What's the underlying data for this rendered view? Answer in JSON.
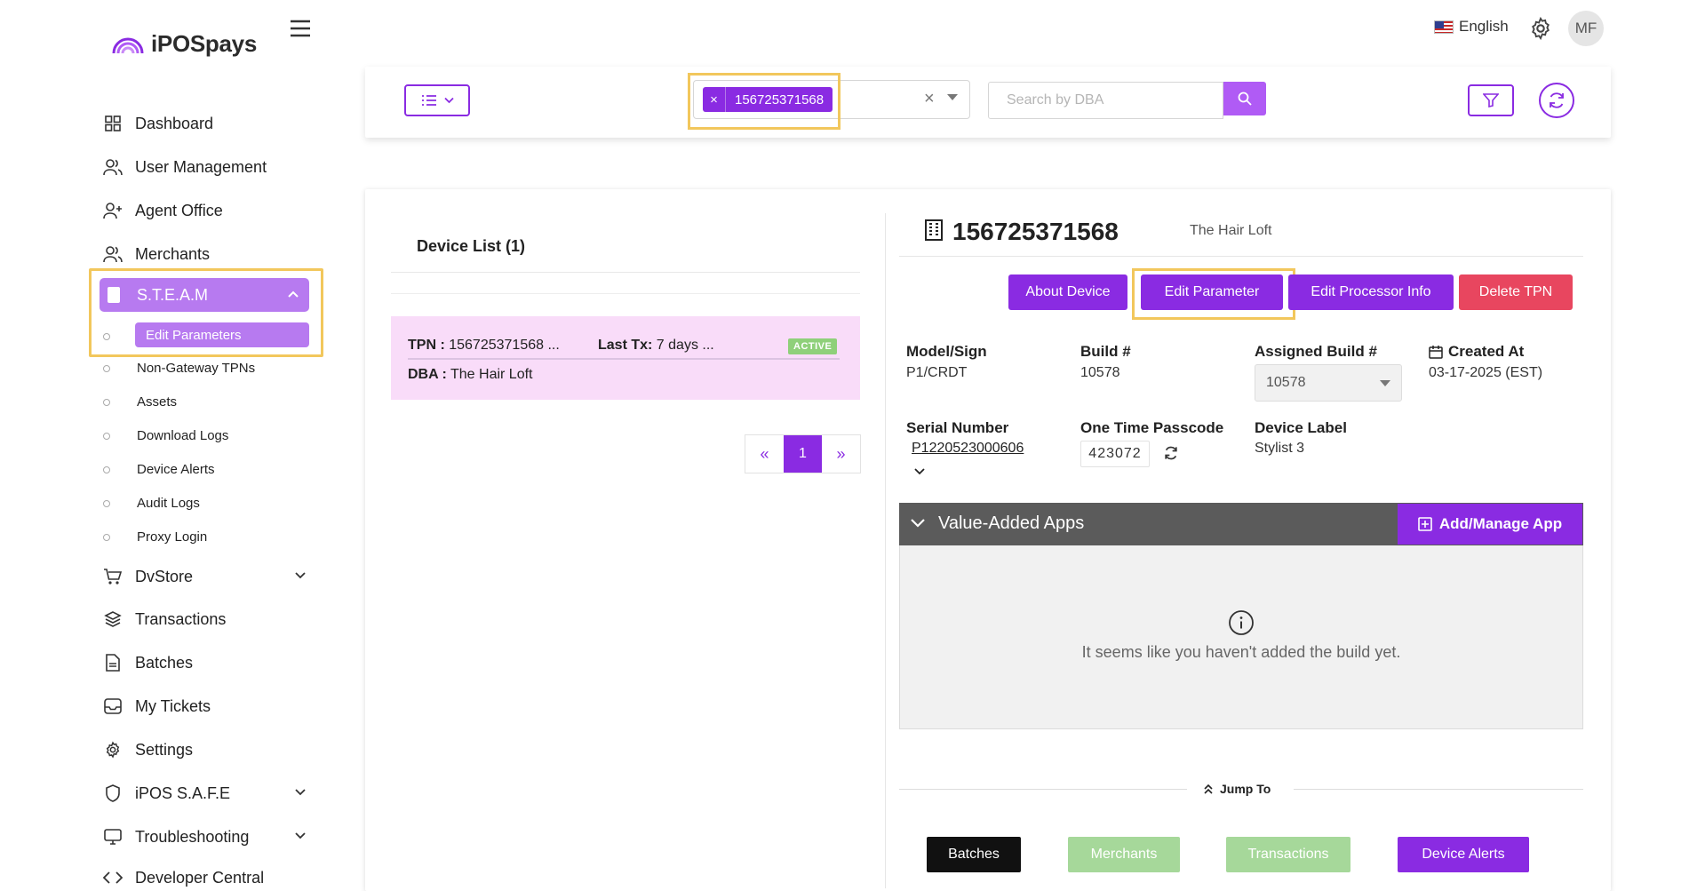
{
  "brand": {
    "name": "iPOSpays"
  },
  "header": {
    "language": "English",
    "avatar_initials": "MF"
  },
  "sidebar": {
    "items": [
      {
        "label": "Dashboard",
        "icon": "grid-icon"
      },
      {
        "label": "User Management",
        "icon": "users-icon"
      },
      {
        "label": "Agent Office",
        "icon": "user-plus-icon"
      },
      {
        "label": "Merchants",
        "icon": "users-icon"
      },
      {
        "label": "S.T.E.A.M",
        "icon": "document-icon",
        "expanded": true,
        "active": true
      }
    ],
    "steam_subitems": [
      {
        "label": "Edit Parameters",
        "active": true
      },
      {
        "label": "Non-Gateway TPNs"
      },
      {
        "label": "Assets"
      },
      {
        "label": "Download Logs"
      },
      {
        "label": "Device Alerts"
      },
      {
        "label": "Audit Logs"
      },
      {
        "label": "Proxy Login"
      }
    ],
    "lower_items": [
      {
        "label": "DvStore",
        "icon": "cart-icon",
        "has_children": true
      },
      {
        "label": "Transactions",
        "icon": "layers-icon"
      },
      {
        "label": "Batches",
        "icon": "file-icon"
      },
      {
        "label": "My Tickets",
        "icon": "inbox-icon"
      },
      {
        "label": "Settings",
        "icon": "gear-icon"
      },
      {
        "label": "iPOS S.A.F.E",
        "icon": "shield-icon",
        "has_children": true
      },
      {
        "label": "Troubleshooting",
        "icon": "monitor-icon",
        "has_children": true
      },
      {
        "label": "Developer Central",
        "icon": "code-icon"
      }
    ]
  },
  "filters": {
    "tpn_chip": "156725371568",
    "search_placeholder": "Search by DBA",
    "highlight_color": "#f2c75c"
  },
  "device_list": {
    "title": "Device List (1)",
    "rows": [
      {
        "tpn_label": "TPN :",
        "tpn": "156725371568 ...",
        "last_tx_label": "Last Tx:",
        "last_tx": "7 days ...",
        "status": "ACTIVE",
        "dba_label": "DBA :",
        "dba": "The Hair Loft"
      }
    ],
    "pagination": {
      "prev": "«",
      "current": "1",
      "next": "»"
    }
  },
  "device_detail": {
    "tpn": "156725371568",
    "dba": "The Hair Loft",
    "actions": {
      "about": "About Device",
      "edit_parameter": "Edit Parameter",
      "edit_processor": "Edit Processor Info",
      "delete": "Delete TPN"
    },
    "fields": {
      "model_label": "Model/Sign",
      "model": "P1/CRDT",
      "build_label": "Build #",
      "build": "10578",
      "assigned_build_label": "Assigned Build #",
      "assigned_build": "10578",
      "created_label": "Created At",
      "created": "03-17-2025 (EST)",
      "serial_label": "Serial Number",
      "serial": "P1220523000606",
      "otp_label": "One Time Passcode",
      "otp": "423072",
      "device_label_label": "Device Label",
      "device_label": "Stylist 3"
    },
    "value_added_apps": {
      "title": "Value-Added Apps",
      "add_button": "Add/Manage App",
      "empty_message": "It seems like you haven't added the build yet."
    },
    "jump_to": {
      "label": "Jump To",
      "buttons": [
        "Batches",
        "Merchants",
        "Transactions",
        "Device Alerts"
      ]
    }
  },
  "colors": {
    "accent": "#8a2be2",
    "accent_light": "#b77af0",
    "danger": "#e8465f",
    "success": "#8fd07a",
    "row_highlight": "#f9dcf9"
  }
}
